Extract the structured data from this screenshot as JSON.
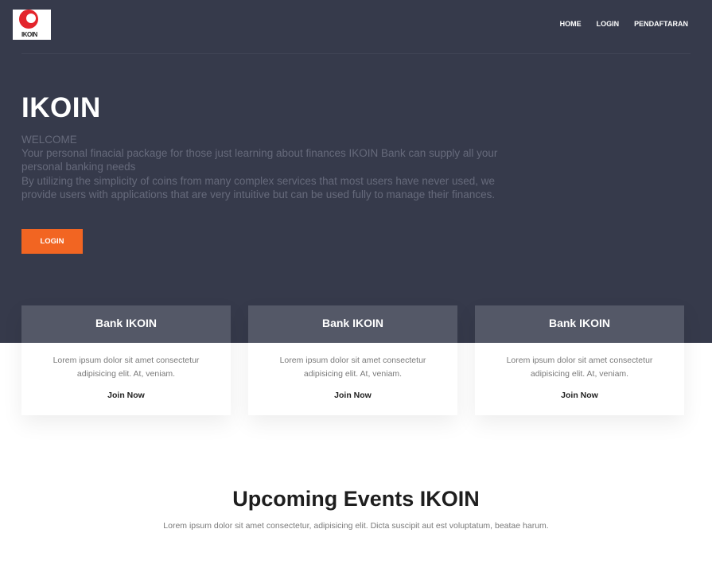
{
  "brand": {
    "logo_text": "IKOIN"
  },
  "nav": {
    "items": [
      "HOME",
      "LOGIN",
      "PENDAFTARAN"
    ]
  },
  "hero": {
    "title": "IKOIN",
    "lines": [
      "WELCOME",
      "Your personal finacial package for those just learning about finances IKOIN Bank can supply all your personal banking needs",
      "By utilizing the simplicity of coins from many complex services that most users have never used, we provide users with applications that are very intuitive but can be used fully to manage their finances."
    ],
    "button_label": "LOGIN"
  },
  "cards": [
    {
      "title": "Bank IKOIN",
      "text": "Lorem ipsum dolor sit amet consectetur adipisicing elit. At, veniam.",
      "link": "Join Now"
    },
    {
      "title": "Bank IKOIN",
      "text": "Lorem ipsum dolor sit amet consectetur adipisicing elit. At, veniam.",
      "link": "Join Now"
    },
    {
      "title": "Bank IKOIN",
      "text": "Lorem ipsum dolor sit amet consectetur adipisicing elit. At, veniam.",
      "link": "Join Now"
    }
  ],
  "events": {
    "title": "Upcoming Events IKOIN",
    "subtitle": "Lorem ipsum dolor sit amet consectetur, adipisicing elit. Dicta suscipit aut est voluptatum, beatae harum."
  },
  "colors": {
    "hero_bg": "#363a4b",
    "accent": "#f26522",
    "card_header": "#545867"
  }
}
